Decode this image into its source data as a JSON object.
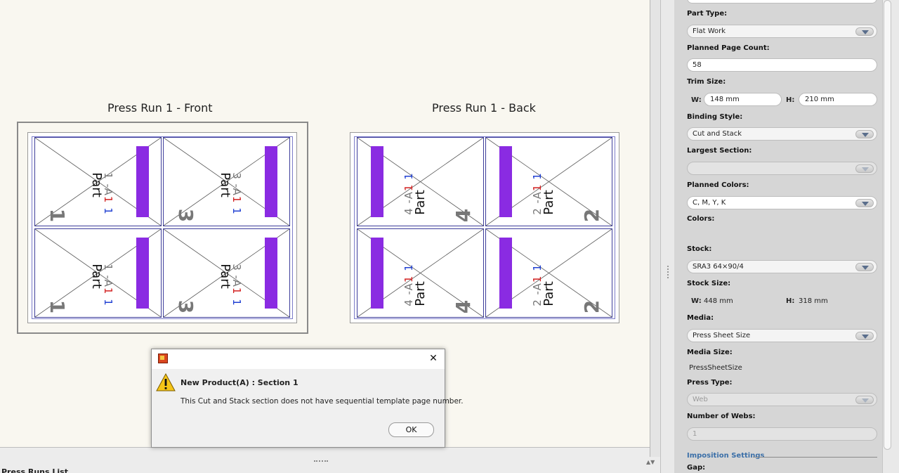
{
  "canvas": {
    "sheets": [
      {
        "title": "Press Run 1 - Front",
        "cells": [
          {
            "row1_pre": "1 -A",
            "row1_red": "1",
            "row1_blue": "1",
            "row2": "Part",
            "big": "1",
            "bar_side": "right"
          },
          {
            "row1_pre": "3 -A",
            "row1_red": "1",
            "row1_blue": "1",
            "row2": "Part",
            "big": "3",
            "bar_side": "right"
          },
          {
            "row1_pre": "1 -A",
            "row1_red": "1",
            "row1_blue": "1",
            "row2": "Part",
            "big": "1",
            "bar_side": "right"
          },
          {
            "row1_pre": "3 -A",
            "row1_red": "1",
            "row1_blue": "1",
            "row2": "Part",
            "big": "3",
            "bar_side": "right"
          }
        ]
      },
      {
        "title": "Press Run 1 - Back",
        "cells": [
          {
            "row1_pre": "4 -A",
            "row1_red": "1",
            "row1_blue": "1",
            "row2": "Part",
            "big": "4",
            "bar_side": "left"
          },
          {
            "row1_pre": "2 -A",
            "row1_red": "1",
            "row1_blue": "1",
            "row2": "Part",
            "big": "2",
            "bar_side": "left"
          },
          {
            "row1_pre": "4 -A",
            "row1_red": "1",
            "row1_blue": "1",
            "row2": "Part",
            "big": "4",
            "bar_side": "left"
          },
          {
            "row1_pre": "2 -A",
            "row1_red": "1",
            "row1_blue": "1",
            "row2": "Part",
            "big": "2",
            "bar_side": "left"
          }
        ]
      }
    ]
  },
  "bottom": {
    "press_runs_title": "Press Runs List"
  },
  "panel": {
    "part_type": {
      "label": "Part Type:",
      "value": "Flat Work"
    },
    "planned_page_count": {
      "label": "Planned Page Count:",
      "value": "58"
    },
    "trim_size": {
      "label": "Trim Size:",
      "w_label": "W:",
      "w_value": "148 mm",
      "h_label": "H:",
      "h_value": "210 mm"
    },
    "binding_style": {
      "label": "Binding Style:",
      "value": "Cut and Stack"
    },
    "largest_section": {
      "label": "Largest Section:",
      "value": ""
    },
    "planned_colors": {
      "label": "Planned Colors:",
      "value": "C, M, Y, K"
    },
    "colors": {
      "label": "Colors:"
    },
    "stock": {
      "label": "Stock:",
      "value": "SRA3 64×90/4"
    },
    "stock_size": {
      "label": "Stock Size:",
      "w_label": "W:",
      "w_value": "448 mm",
      "h_label": "H:",
      "h_value": "318 mm"
    },
    "media": {
      "label": "Media:",
      "value": "Press Sheet Size"
    },
    "media_size": {
      "label": "Media Size:",
      "value": "PressSheetSize"
    },
    "press_type": {
      "label": "Press Type:",
      "value": "Web"
    },
    "number_of_webs": {
      "label": "Number of Webs:",
      "value": "1"
    },
    "imposition_settings": "Imposition Settings",
    "gap": {
      "label": "Gap:"
    }
  },
  "dialog": {
    "heading": "New Product(A) : Section 1",
    "message": "This Cut and Stack section does not have sequential template page number.",
    "ok_label": "OK",
    "close_glyph": "✕"
  },
  "colors": {
    "bar": "#8a2be2",
    "accent_red": "#d21f1f",
    "accent_blue": "#1f3fd2",
    "link": "#3b6fa8"
  }
}
